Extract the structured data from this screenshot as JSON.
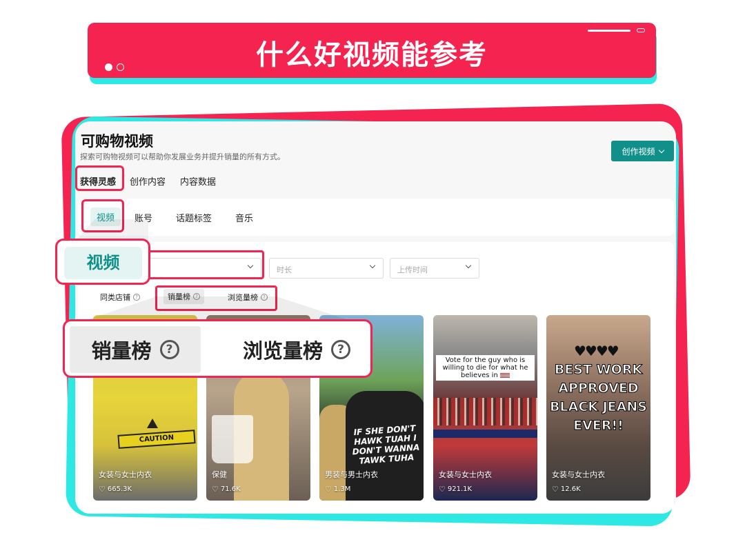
{
  "banner": {
    "title": "什么好视频能参考"
  },
  "page": {
    "title": "可购物视频",
    "subtitle": "探索可购物视频可以帮助你发展业务并提升销量的所有方式。",
    "create_button": "创作视频"
  },
  "main_tabs": [
    "获得灵感",
    "创作内容",
    "内容数据"
  ],
  "sub_tabs": [
    "视频",
    "账号",
    "话题标签",
    "音乐"
  ],
  "filters": {
    "duration_placeholder": "时长",
    "upload_time_placeholder": "上传时间"
  },
  "rankings": [
    "同类店铺",
    "销量榜",
    "浏览量榜"
  ],
  "help_symbol": "?",
  "zoom": {
    "tab_label": "视频",
    "sales_rank": "销量榜",
    "views_rank": "浏览量榜"
  },
  "videos": [
    {
      "category": "女装与女士内衣",
      "likes": "665.3K",
      "overlay": "CAUTION"
    },
    {
      "category": "保健",
      "likes": "71.6K"
    },
    {
      "category": "男装与男士内衣",
      "likes": "1.3M",
      "overlay": "IF SHE DON'T HAWK TUAH I DON'T WANNA TAWK TUHA"
    },
    {
      "category": "女装与女士内衣",
      "likes": "921.1K",
      "overlay": "Vote for the guy who is willing to die for what he believes in"
    },
    {
      "category": "女装与女士内衣",
      "likes": "12.6K",
      "overlay": "BEST WORK APPROVED BLACK JEANS EVER!!"
    }
  ],
  "colors": {
    "accent_red": "#f4234f",
    "accent_cyan": "#2ee8e4",
    "teal": "#11908a"
  },
  "icons": {
    "heart": "heart-outline-icon",
    "help": "question-circle-icon",
    "chevron": "chevron-down-icon"
  }
}
